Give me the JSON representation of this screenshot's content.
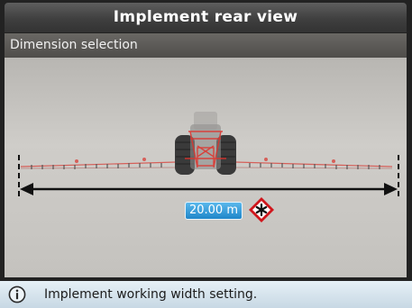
{
  "window": {
    "title": "Implement rear view"
  },
  "section": {
    "title": "Dimension selection"
  },
  "dimension": {
    "value_label": "20.00 m"
  },
  "status": {
    "message": "Implement working width setting.",
    "icon": "info-icon"
  },
  "colors": {
    "accent_blue": "#1f86c9",
    "edit_red": "#d0161c",
    "boom_red": "#d8453e"
  }
}
